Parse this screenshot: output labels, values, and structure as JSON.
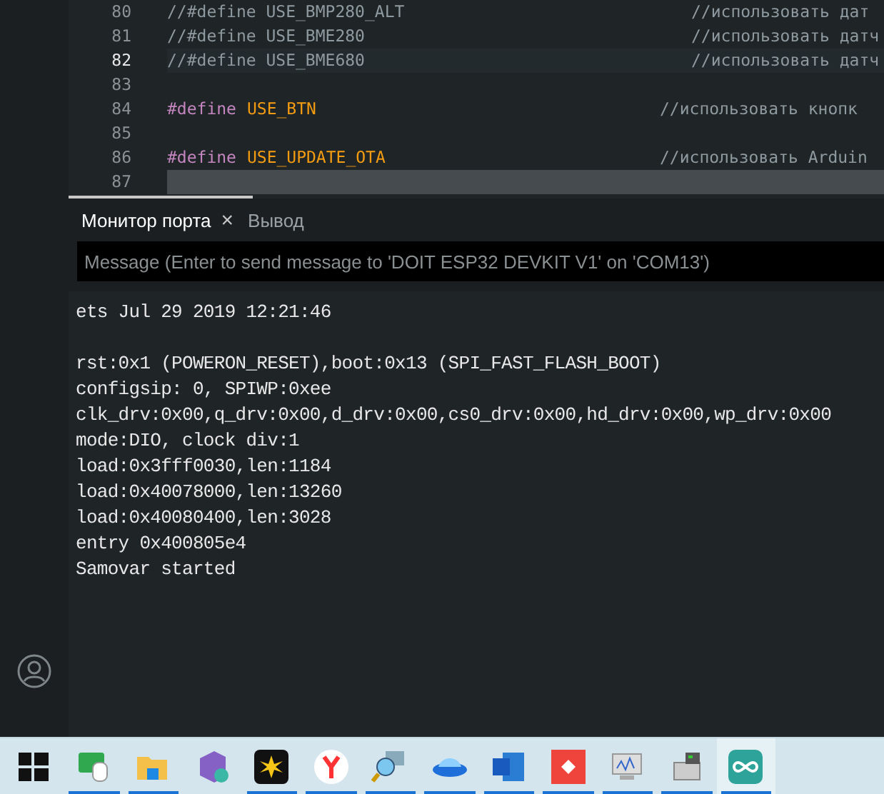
{
  "editor": {
    "lines": [
      {
        "number": "80",
        "current": false,
        "selected": false,
        "code": [
          {
            "kind": "comment",
            "text": "//#define USE_BMP280_ALT"
          }
        ],
        "comment": "//использовать дат"
      },
      {
        "number": "81",
        "current": false,
        "selected": false,
        "code": [
          {
            "kind": "comment",
            "text": "//#define USE_BME280"
          }
        ],
        "comment": "//использовать датч"
      },
      {
        "number": "82",
        "current": true,
        "selected": false,
        "code": [
          {
            "kind": "comment",
            "text": "//#define USE_BME680"
          }
        ],
        "comment": "//использовать датч"
      },
      {
        "number": "83",
        "current": false,
        "selected": false
      },
      {
        "number": "84",
        "current": false,
        "selected": false,
        "code": [
          {
            "kind": "directive",
            "text": "#define"
          },
          {
            "kind": "macro",
            "text": "USE_BTN"
          }
        ],
        "comment": "//использовать кнопк"
      },
      {
        "number": "85",
        "current": false,
        "selected": false
      },
      {
        "number": "86",
        "current": false,
        "selected": false,
        "code": [
          {
            "kind": "directive",
            "text": "#define"
          },
          {
            "kind": "macro",
            "text": "USE_UPDATE_OTA"
          }
        ],
        "comment": "//использовать Arduin"
      },
      {
        "number": "87",
        "current": false,
        "selected": true
      }
    ]
  },
  "panel": {
    "tabs": [
      {
        "label": "Монитор порта",
        "selected": true,
        "close": "×"
      },
      {
        "label": "Вывод",
        "selected": false
      }
    ],
    "message": {
      "placeholder": "Message (Enter to send message to 'DOIT ESP32 DEVKIT V1' on 'COM13')"
    },
    "output": "ets Jul 29 2019 12:21:46\n\nrst:0x1 (POWERON_RESET),boot:0x13 (SPI_FAST_FLASH_BOOT)\nconfigsip: 0, SPIWP:0xee\nclk_drv:0x00,q_drv:0x00,d_drv:0x00,cs0_drv:0x00,hd_drv:0x00,wp_drv:0x00\nmode:DIO, clock div:1\nload:0x3fff0030,len:1184\nload:0x40078000,len:13260\nload:0x40080400,len:3028\nentry 0x400805e4\nSamovar started"
  },
  "taskbar": {
    "items": [
      {
        "kind": "start",
        "running": false,
        "active": false
      },
      {
        "kind": "remote",
        "running": true,
        "active": false
      },
      {
        "kind": "folder",
        "running": true,
        "active": false
      },
      {
        "kind": "studio",
        "running": false,
        "active": false
      },
      {
        "kind": "burst",
        "running": true,
        "active": false
      },
      {
        "kind": "browser",
        "running": true,
        "active": false
      },
      {
        "kind": "network",
        "running": true,
        "active": false
      },
      {
        "kind": "disk",
        "running": true,
        "active": false
      },
      {
        "kind": "word",
        "running": true,
        "active": false
      },
      {
        "kind": "anydesk",
        "running": true,
        "active": false
      },
      {
        "kind": "monitor",
        "running": true,
        "active": false
      },
      {
        "kind": "computer",
        "running": true,
        "active": false
      },
      {
        "kind": "arduino",
        "running": true,
        "active": true
      }
    ]
  }
}
